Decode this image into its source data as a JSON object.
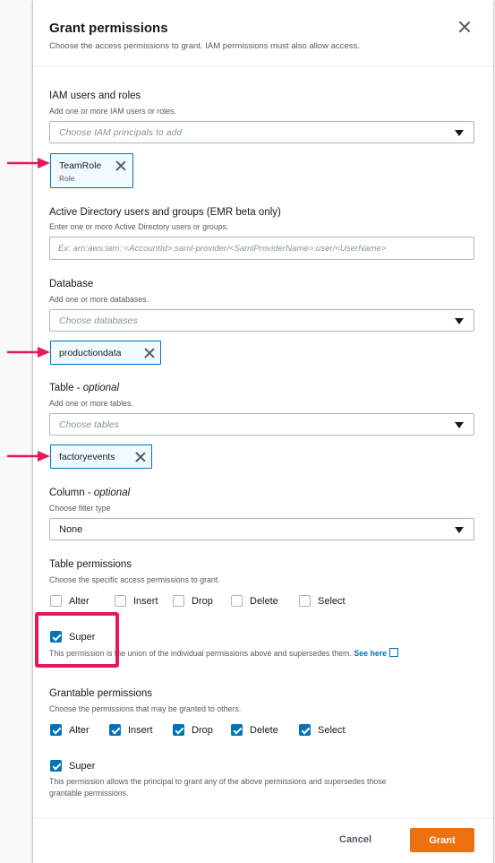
{
  "modal": {
    "title": "Grant permissions",
    "subtitle": "Choose the access permissions to grant. IAM permissions must also allow access."
  },
  "iam": {
    "label": "IAM users and roles",
    "desc": "Add one or more IAM users or roles.",
    "placeholder": "Choose IAM principals to add",
    "token_name": "TeamRole",
    "token_sub": "Role"
  },
  "ad": {
    "label": "Active Directory users and groups (EMR beta only)",
    "desc": "Enter one or more Active Directory users or groups.",
    "placeholder": "Ex: arn:aws:iam::<AccountId>:saml-provider/<SamlProviderName>:user/<UserName>"
  },
  "database": {
    "label": "Database",
    "desc": "Add one or more databases.",
    "placeholder": "Choose databases",
    "token_name": "productiondata"
  },
  "table": {
    "label": "Table - ",
    "label_optional": "optional",
    "desc": "Add one or more tables.",
    "placeholder": "Choose tables",
    "token_name": "factoryevents"
  },
  "column": {
    "label": "Column - ",
    "label_optional": "optional",
    "desc": "Choose filter type",
    "value": "None"
  },
  "table_permissions": {
    "label": "Table permissions",
    "desc": "Choose the specific access permissions to grant.",
    "options": [
      "Alter",
      "Insert",
      "Drop",
      "Delete",
      "Select"
    ],
    "super_label": "Super",
    "super_note": "This permission is the union of the individual permissions above and supersedes them.",
    "see_here": "See here"
  },
  "grantable_permissions": {
    "label": "Grantable permissions",
    "desc": "Choose the permissions that may be granted to others.",
    "options": [
      "Alter",
      "Insert",
      "Drop",
      "Delete",
      "Select"
    ],
    "super_label": "Super",
    "super_note_line1": "This permission allows the principal to grant any of the above permissions and supersedes those",
    "super_note_line2": "grantable permissions."
  },
  "footer": {
    "cancel_label": "Cancel",
    "grant_label": "Grant"
  },
  "colors": {
    "accent": "#0073bb",
    "primary_button": "#ec7211",
    "annotation": "#e8175d"
  }
}
